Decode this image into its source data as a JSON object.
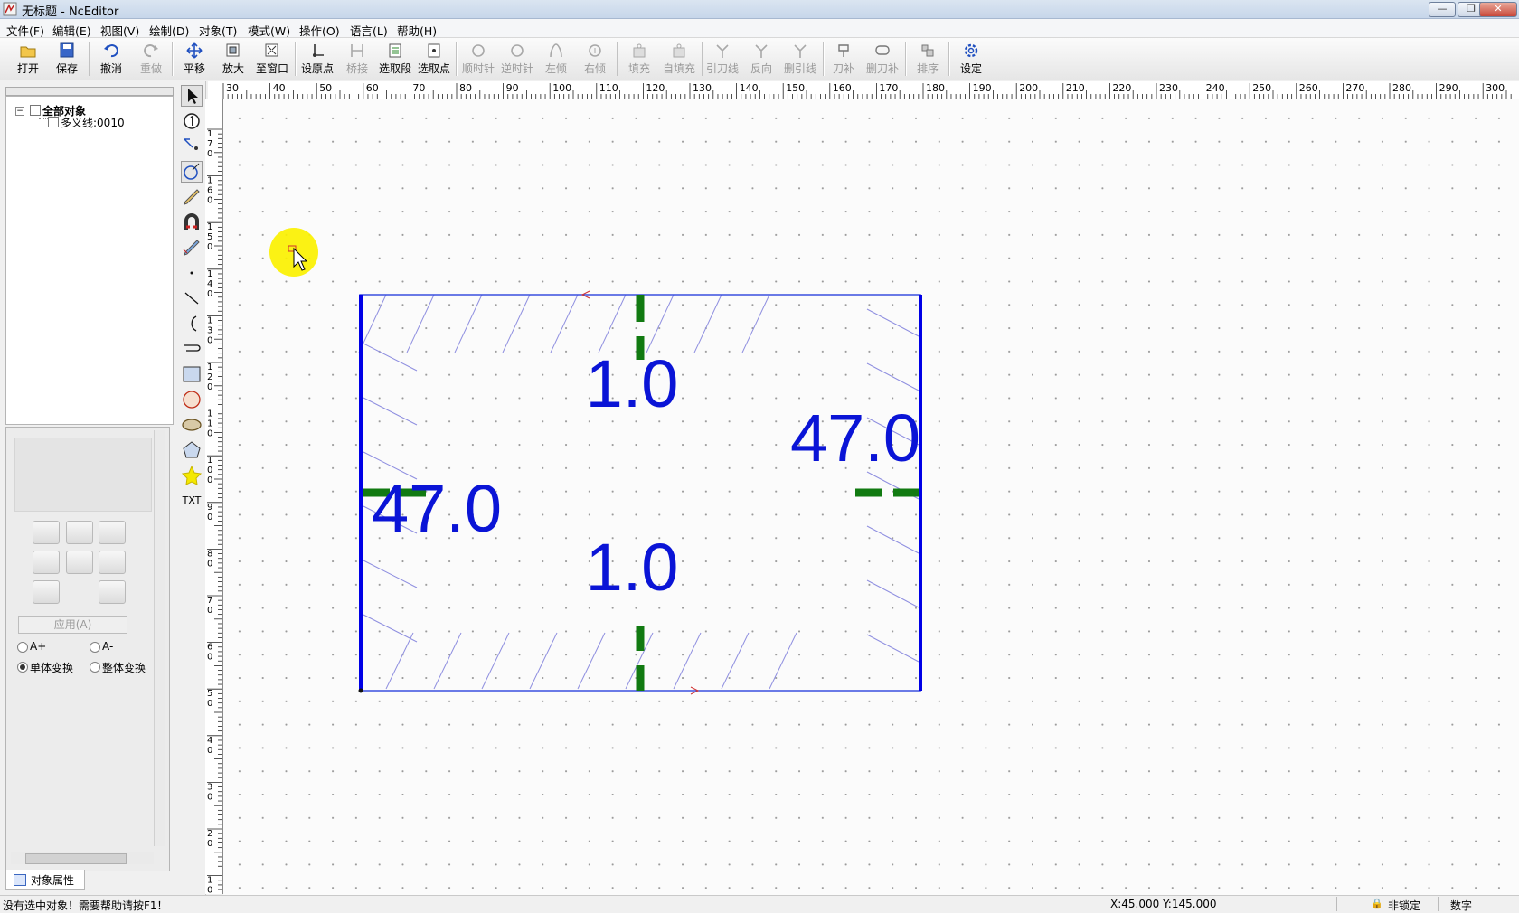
{
  "window": {
    "title": "无标题 - NcEditor",
    "buttons": {
      "minimize": "—",
      "restore": "❐",
      "close": "✕"
    }
  },
  "menu": [
    "文件(F)",
    "编辑(E)",
    "视图(V)",
    "绘制(D)",
    "对象(T)",
    "模式(W)",
    "操作(O)",
    "语言(L)",
    "帮助(H)"
  ],
  "toolbar": [
    {
      "label": "打开",
      "icon": "open-icon",
      "enabled": true
    },
    {
      "label": "保存",
      "icon": "save-icon",
      "enabled": true
    },
    {
      "label": "撤消",
      "icon": "undo-icon",
      "enabled": true
    },
    {
      "label": "重做",
      "icon": "redo-icon",
      "enabled": false
    },
    {
      "label": "平移",
      "icon": "pan-icon",
      "enabled": true
    },
    {
      "label": "放大",
      "icon": "zoom-in-icon",
      "enabled": true
    },
    {
      "label": "至窗口",
      "icon": "fit-window-icon",
      "enabled": true
    },
    {
      "label": "设原点",
      "icon": "set-origin-icon",
      "enabled": true
    },
    {
      "label": "桥接",
      "icon": "bridge-icon",
      "enabled": false
    },
    {
      "label": "选取段",
      "icon": "select-segment-icon",
      "enabled": true
    },
    {
      "label": "选取点",
      "icon": "select-point-icon",
      "enabled": true
    },
    {
      "label": "顺时针",
      "icon": "clockwise-icon",
      "enabled": false
    },
    {
      "label": "逆时针",
      "icon": "counterclockwise-icon",
      "enabled": false
    },
    {
      "label": "左倾",
      "icon": "lean-left-icon",
      "enabled": false
    },
    {
      "label": "右倾",
      "icon": "lean-right-icon",
      "enabled": false
    },
    {
      "label": "填充",
      "icon": "fill-icon",
      "enabled": false
    },
    {
      "label": "自填充",
      "icon": "auto-fill-icon",
      "enabled": false
    },
    {
      "label": "引刀线",
      "icon": "lead-line-icon",
      "enabled": false
    },
    {
      "label": "反向",
      "icon": "reverse-icon",
      "enabled": false
    },
    {
      "label": "删引线",
      "icon": "delete-lead-icon",
      "enabled": false
    },
    {
      "label": "刀补",
      "icon": "tool-comp-icon",
      "enabled": false
    },
    {
      "label": "删刀补",
      "icon": "delete-comp-icon",
      "enabled": false
    },
    {
      "label": "排序",
      "icon": "sort-icon",
      "enabled": false
    },
    {
      "label": "设定",
      "icon": "settings-icon",
      "enabled": true
    }
  ],
  "tree": {
    "root": "全部对象",
    "child": "多义线:0010"
  },
  "transform": {
    "apply_label": "应用(A)",
    "radio_a_plus": "A+",
    "radio_a_minus": "A-",
    "single": "单体变换",
    "whole": "整体变换"
  },
  "props_tab": "对象属性",
  "tools": [
    "select-arrow-icon",
    "number-one-icon",
    "node-select-icon",
    "circle-tool-icon",
    "pencil-icon",
    "magnet-icon",
    "edit-path-icon",
    "point-icon",
    "line-icon",
    "arc-icon",
    "polyline-icon",
    "rectangle-icon",
    "circle-icon",
    "ellipse-icon",
    "polygon-icon",
    "star-icon",
    "text-icon"
  ],
  "text_tool_label": "TXT",
  "ruler": {
    "top": [
      "30",
      "40",
      "50",
      "60",
      "70",
      "80",
      "90",
      "100",
      "110",
      "120",
      "130",
      "140",
      "150",
      "160",
      "170",
      "180",
      "190",
      "200",
      "210",
      "220",
      "230",
      "240",
      "250",
      "260",
      "270",
      "280",
      "290",
      "300"
    ],
    "left": [
      "170",
      "160",
      "150",
      "140",
      "130",
      "120",
      "110",
      "100",
      "90",
      "80",
      "70",
      "60",
      "50",
      "40",
      "30",
      "20",
      "10"
    ]
  },
  "drawing": {
    "labels": {
      "top": "1.0",
      "bottom": "1.0",
      "left": "47.0",
      "right": "47.0"
    },
    "colors": {
      "outline": "#0000e6",
      "marker": "#117a11",
      "hatch": "#8f8fe0",
      "text": "#0a14d6"
    }
  },
  "status": {
    "message": "没有选中对象！需要帮助请按F1！",
    "coords": "X:45.000  Y:145.000",
    "lock": "非锁定",
    "mode": "数字"
  }
}
